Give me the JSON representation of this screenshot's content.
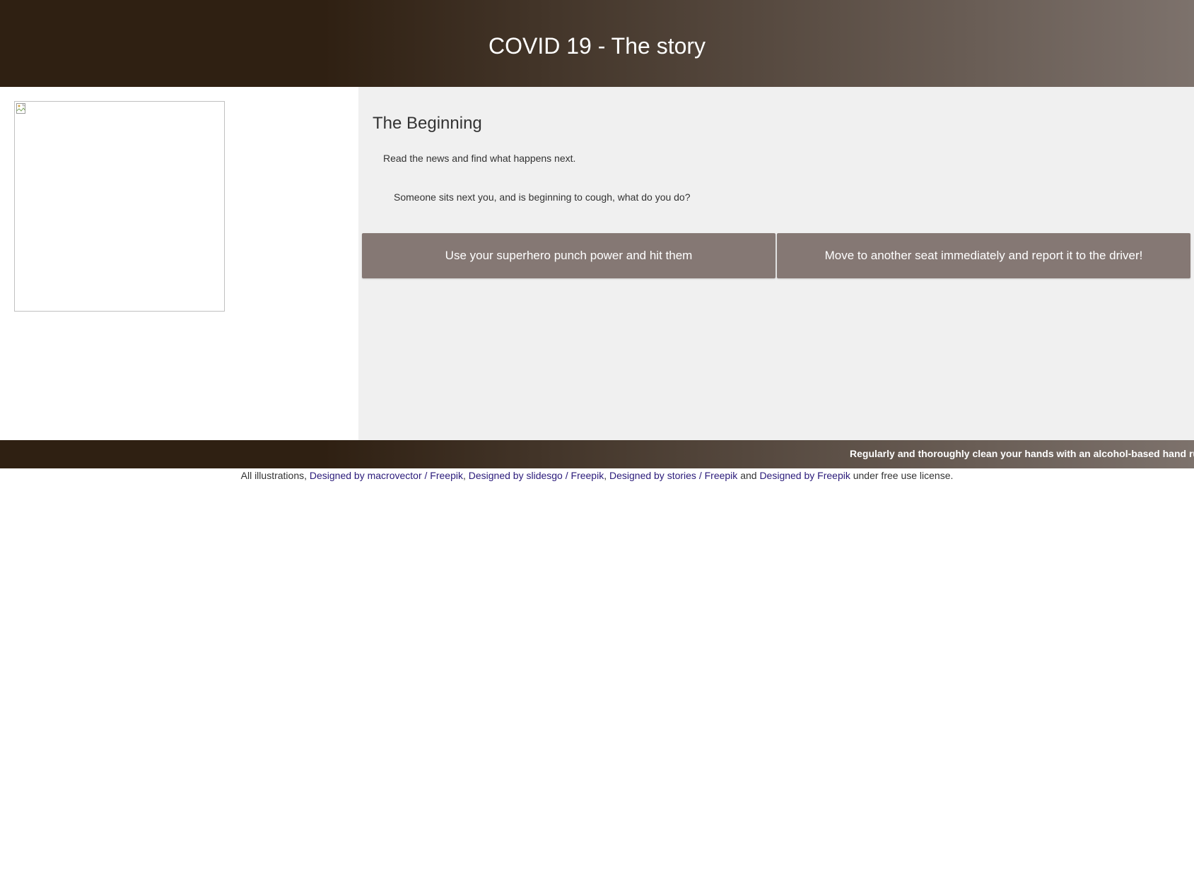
{
  "header": {
    "title": "COVID 19 - The story",
    "gradient_start": "#2f2012",
    "gradient_end": "#7d726c"
  },
  "story": {
    "image_icon": "broken-image-icon",
    "section_title": "The Beginning",
    "intro": "Read the news and find what happens next.",
    "question": "Someone sits next you, and is beginning to cough, what do you do?",
    "choices": [
      {
        "label": "Use your superhero punch power and hit them"
      },
      {
        "label": "Move to another seat immediately and report it to the driver!"
      }
    ],
    "button_color": "#857874",
    "panel_color": "#f0f0f0"
  },
  "ticker": {
    "text": "Regularly and thoroughly clean your hands with an alcohol-based hand rub or w"
  },
  "credits": {
    "prefix": "All illustrations,",
    "link1": "Designed by macrovector / Freepik",
    "sep1": ",",
    "link2": "Designed by slidesgo / Freepik",
    "sep2": ",",
    "link3": "Designed by stories / Freepik",
    "and": "and",
    "link4": "Designed by Freepik",
    "suffix": "under free use license."
  }
}
